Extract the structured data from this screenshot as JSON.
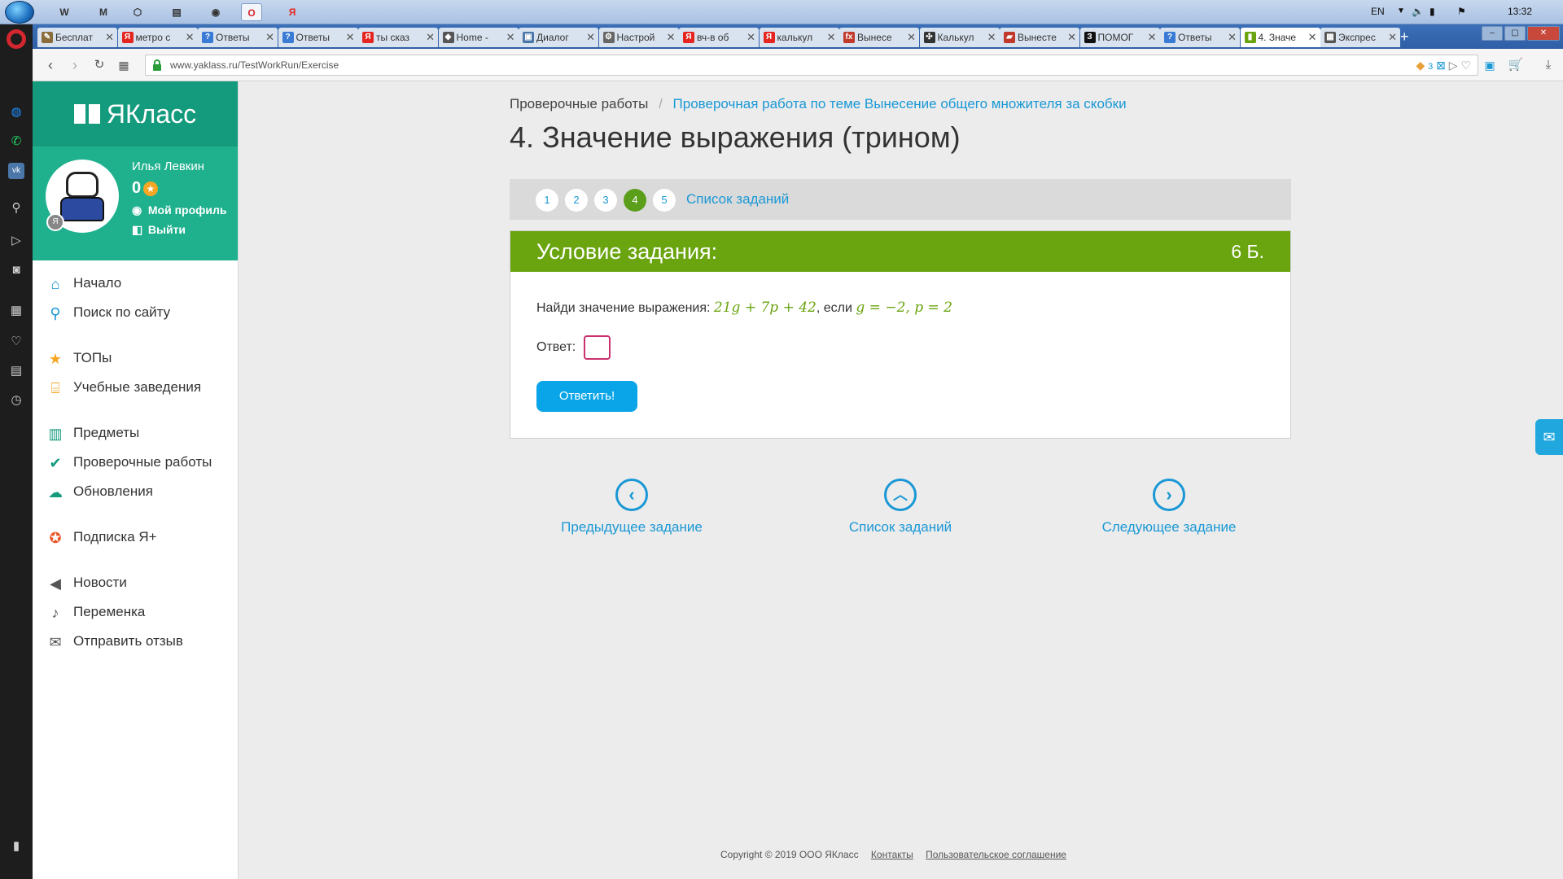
{
  "taskbar": {
    "clock": "13:32",
    "lang": "EN",
    "pinned": [
      "W",
      "M",
      "⬡",
      "▤",
      "◉",
      "O",
      "Я"
    ]
  },
  "browser": {
    "tabs": [
      {
        "label": "Бесплат",
        "fav": "✎",
        "color": "#8a6d3b"
      },
      {
        "label": "метро с",
        "fav": "Я",
        "color": "#e52620"
      },
      {
        "label": "Ответы",
        "fav": "?",
        "color": "#3a7bd5"
      },
      {
        "label": "Ответы",
        "fav": "?",
        "color": "#3a7bd5"
      },
      {
        "label": "ты сказ",
        "fav": "Я",
        "color": "#e52620"
      },
      {
        "label": "Home -",
        "fav": "◆",
        "color": "#555555"
      },
      {
        "label": "Диалог",
        "fav": "▣",
        "color": "#4a76a8"
      },
      {
        "label": "Настрой",
        "fav": "⚙",
        "color": "#666666"
      },
      {
        "label": "вч-в об",
        "fav": "Я",
        "color": "#e52620"
      },
      {
        "label": "калькул",
        "fav": "Я",
        "color": "#e52620"
      },
      {
        "label": "Вынесе",
        "fav": "fx",
        "color": "#c0392b"
      },
      {
        "label": "Калькул",
        "fav": "✣",
        "color": "#333333"
      },
      {
        "label": "Вынесте",
        "fav": "▰",
        "color": "#c0392b"
      },
      {
        "label": "ПОМОГ",
        "fav": "З",
        "color": "#111111"
      },
      {
        "label": "Ответы",
        "fav": "?",
        "color": "#3a7bd5"
      },
      {
        "label": "4. Значе",
        "fav": "▮",
        "color": "#6aa40f"
      },
      {
        "label": "Экспрес",
        "fav": "▦",
        "color": "#555555"
      }
    ],
    "active_tab": 15,
    "url": "www.yaklass.ru/TestWorkRun/Exercise",
    "url_badge": "3"
  },
  "opera_sidebar": [
    "messenger-icon",
    "whatsapp-icon",
    "vk-icon",
    "search-icon",
    "send-icon",
    "camera-icon",
    "grid-icon",
    "heart-icon",
    "news-icon",
    "history-icon"
  ],
  "site": {
    "logo": "ЯКласс",
    "user": {
      "name": "Илья Левкин",
      "score": "0",
      "profile_link": "Мой профиль",
      "logout_link": "Выйти",
      "badge": "Я"
    },
    "menu": [
      {
        "label": "Начало",
        "icon": "⌂",
        "color": "#1a98d5",
        "name": "home"
      },
      {
        "label": "Поиск по сайту",
        "icon": "⚲",
        "color": "#1a98d5",
        "name": "search"
      },
      {
        "gap": true
      },
      {
        "label": "ТОПы",
        "icon": "★",
        "color": "#f5a623",
        "name": "tops"
      },
      {
        "label": "Учебные заведения",
        "icon": "⌸",
        "color": "#f5a623",
        "name": "schools"
      },
      {
        "gap": true
      },
      {
        "label": "Предметы",
        "icon": "▥",
        "color": "#149a7d",
        "name": "subjects"
      },
      {
        "label": "Проверочные работы",
        "icon": "✔",
        "color": "#149a7d",
        "name": "tests"
      },
      {
        "label": "Обновления",
        "icon": "☁",
        "color": "#149a7d",
        "name": "updates"
      },
      {
        "gap": true
      },
      {
        "label": "Подписка Я+",
        "icon": "✪",
        "color": "#e8582c",
        "name": "subscription"
      },
      {
        "gap": true
      },
      {
        "label": "Новости",
        "icon": "◀",
        "color": "#555555",
        "name": "news"
      },
      {
        "label": "Переменка",
        "icon": "♪",
        "color": "#555555",
        "name": "break"
      },
      {
        "label": "Отправить отзыв",
        "icon": "✉",
        "color": "#555555",
        "name": "feedback"
      }
    ]
  },
  "main": {
    "breadcrumb_root": "Проверочные работы",
    "breadcrumb_sep": "/",
    "breadcrumb_link": "Проверочная работа по теме Вынесение общего множителя за скобки",
    "title": "4. Значение выражения (трином)",
    "task_numbers": [
      "1",
      "2",
      "3",
      "4",
      "5"
    ],
    "current_task": 3,
    "task_list_link": "Список заданий",
    "card_title": "Условие задания:",
    "card_points": "6 Б.",
    "task_prefix": "Найди значение выражения:",
    "expression": "21g + 7p + 42",
    "task_middle": ", если",
    "condition": "g = −2, p = 2",
    "answer_label": "Ответ:",
    "answer_value": "",
    "submit_label": "Ответить!",
    "prev_label": "Предыдущее задание",
    "list_label": "Список заданий",
    "next_label": "Следующее задание"
  },
  "footer": {
    "copyright": "Copyright © 2019 ООО ЯКласс",
    "contacts": "Контакты",
    "agreement": "Пользовательское соглашение"
  }
}
